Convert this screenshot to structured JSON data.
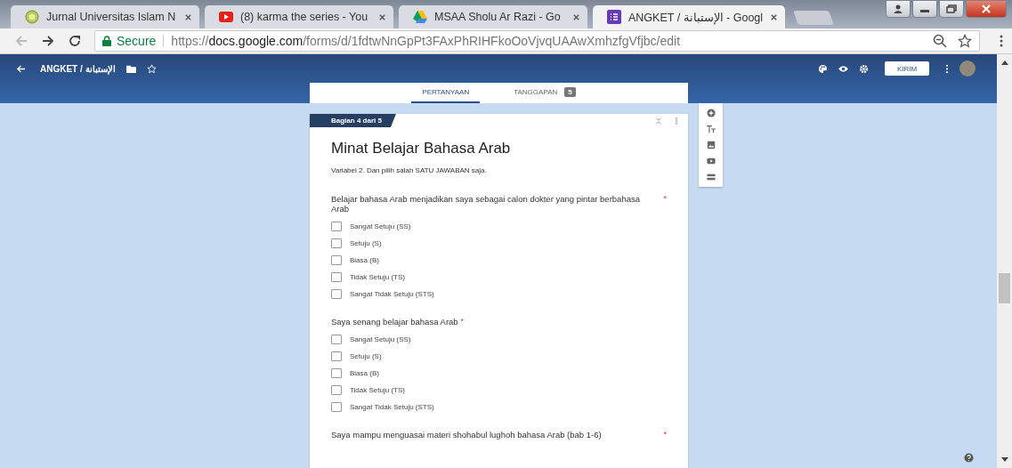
{
  "browser": {
    "tabs": [
      {
        "title": "Jurnal Universitas Islam N",
        "kind": "site",
        "selected": false
      },
      {
        "title": "(8) karma the series - You",
        "kind": "video",
        "selected": false
      },
      {
        "title": "MSAA Sholu Ar Razi - Go",
        "kind": "drive",
        "selected": false
      },
      {
        "title": "ANGKET / الإستبانة - Googl",
        "kind": "forms",
        "selected": true
      }
    ],
    "secure_label": "Secure",
    "url_scheme": "https://",
    "url_host": "docs.google.com",
    "url_path": "/forms/d/1fdtwNnGpPt3FAxPhRIHFkoOoVjvqUAAwXmhzfgVfjbc/edit"
  },
  "header": {
    "title": "ANGKET / الإستبانة",
    "send_button": "KIRIM"
  },
  "form_tabs": [
    {
      "label": "PERTANYAAN",
      "selected": true
    },
    {
      "label": "TANGGAPAN",
      "count": "5",
      "selected": false
    }
  ],
  "section": {
    "badge": "Bagian 4 dari 5",
    "title": "Minat Belajar Bahasa Arab",
    "description": "Variabel 2. Dan pilih salah SATU JAWABAN saja."
  },
  "questions": [
    {
      "text": "Belajar bahasa Arab menjadikan saya sebagai calon dokter yang pintar berbahasa Arab",
      "required_mark": "*",
      "options": [
        {
          "label": "Sangat Setuju (SS)",
          "checked": false
        },
        {
          "label": "Setuju (S)",
          "checked": false
        },
        {
          "label": "Biasa (B)",
          "checked": false
        },
        {
          "label": "Tidak Setuju (TS)",
          "checked": false
        },
        {
          "label": "Sangat Tidak Setuju (STS)",
          "checked": false
        }
      ]
    },
    {
      "text": "Saya senang belajar bahasa Arab",
      "required_mark": "*",
      "options": [
        {
          "label": "Sangat Setuju (SS)",
          "checked": false
        },
        {
          "label": "Setuju (S)",
          "checked": false
        },
        {
          "label": "Biasa (B)",
          "checked": false
        },
        {
          "label": "Tidak Setuju (TS)",
          "checked": false
        },
        {
          "label": "Sangat Tidak Setuju (STS)",
          "checked": false
        }
      ]
    },
    {
      "text": "Saya mampu menguasai materi shohabul lughoh bahasa Arab (bab 1-6)",
      "required_mark": "*"
    }
  ]
}
